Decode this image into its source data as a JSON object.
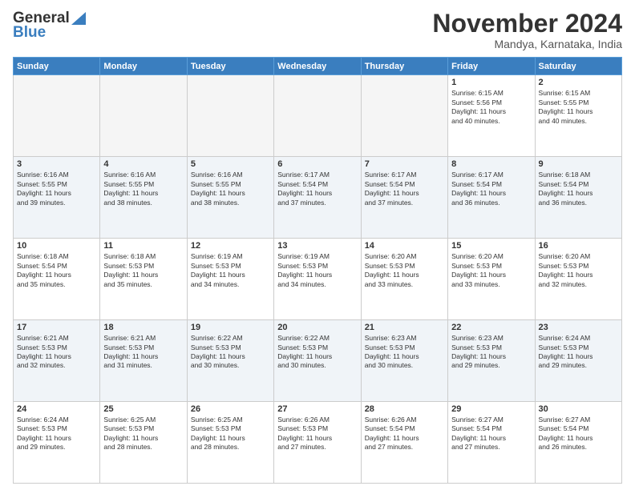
{
  "logo": {
    "line1": "General",
    "line2": "Blue"
  },
  "header": {
    "month": "November 2024",
    "location": "Mandya, Karnataka, India"
  },
  "weekdays": [
    "Sunday",
    "Monday",
    "Tuesday",
    "Wednesday",
    "Thursday",
    "Friday",
    "Saturday"
  ],
  "weeks": [
    [
      {
        "day": "",
        "info": ""
      },
      {
        "day": "",
        "info": ""
      },
      {
        "day": "",
        "info": ""
      },
      {
        "day": "",
        "info": ""
      },
      {
        "day": "",
        "info": ""
      },
      {
        "day": "1",
        "info": "Sunrise: 6:15 AM\nSunset: 5:56 PM\nDaylight: 11 hours\nand 40 minutes."
      },
      {
        "day": "2",
        "info": "Sunrise: 6:15 AM\nSunset: 5:55 PM\nDaylight: 11 hours\nand 40 minutes."
      }
    ],
    [
      {
        "day": "3",
        "info": "Sunrise: 6:16 AM\nSunset: 5:55 PM\nDaylight: 11 hours\nand 39 minutes."
      },
      {
        "day": "4",
        "info": "Sunrise: 6:16 AM\nSunset: 5:55 PM\nDaylight: 11 hours\nand 38 minutes."
      },
      {
        "day": "5",
        "info": "Sunrise: 6:16 AM\nSunset: 5:55 PM\nDaylight: 11 hours\nand 38 minutes."
      },
      {
        "day": "6",
        "info": "Sunrise: 6:17 AM\nSunset: 5:54 PM\nDaylight: 11 hours\nand 37 minutes."
      },
      {
        "day": "7",
        "info": "Sunrise: 6:17 AM\nSunset: 5:54 PM\nDaylight: 11 hours\nand 37 minutes."
      },
      {
        "day": "8",
        "info": "Sunrise: 6:17 AM\nSunset: 5:54 PM\nDaylight: 11 hours\nand 36 minutes."
      },
      {
        "day": "9",
        "info": "Sunrise: 6:18 AM\nSunset: 5:54 PM\nDaylight: 11 hours\nand 36 minutes."
      }
    ],
    [
      {
        "day": "10",
        "info": "Sunrise: 6:18 AM\nSunset: 5:54 PM\nDaylight: 11 hours\nand 35 minutes."
      },
      {
        "day": "11",
        "info": "Sunrise: 6:18 AM\nSunset: 5:53 PM\nDaylight: 11 hours\nand 35 minutes."
      },
      {
        "day": "12",
        "info": "Sunrise: 6:19 AM\nSunset: 5:53 PM\nDaylight: 11 hours\nand 34 minutes."
      },
      {
        "day": "13",
        "info": "Sunrise: 6:19 AM\nSunset: 5:53 PM\nDaylight: 11 hours\nand 34 minutes."
      },
      {
        "day": "14",
        "info": "Sunrise: 6:20 AM\nSunset: 5:53 PM\nDaylight: 11 hours\nand 33 minutes."
      },
      {
        "day": "15",
        "info": "Sunrise: 6:20 AM\nSunset: 5:53 PM\nDaylight: 11 hours\nand 33 minutes."
      },
      {
        "day": "16",
        "info": "Sunrise: 6:20 AM\nSunset: 5:53 PM\nDaylight: 11 hours\nand 32 minutes."
      }
    ],
    [
      {
        "day": "17",
        "info": "Sunrise: 6:21 AM\nSunset: 5:53 PM\nDaylight: 11 hours\nand 32 minutes."
      },
      {
        "day": "18",
        "info": "Sunrise: 6:21 AM\nSunset: 5:53 PM\nDaylight: 11 hours\nand 31 minutes."
      },
      {
        "day": "19",
        "info": "Sunrise: 6:22 AM\nSunset: 5:53 PM\nDaylight: 11 hours\nand 30 minutes."
      },
      {
        "day": "20",
        "info": "Sunrise: 6:22 AM\nSunset: 5:53 PM\nDaylight: 11 hours\nand 30 minutes."
      },
      {
        "day": "21",
        "info": "Sunrise: 6:23 AM\nSunset: 5:53 PM\nDaylight: 11 hours\nand 30 minutes."
      },
      {
        "day": "22",
        "info": "Sunrise: 6:23 AM\nSunset: 5:53 PM\nDaylight: 11 hours\nand 29 minutes."
      },
      {
        "day": "23",
        "info": "Sunrise: 6:24 AM\nSunset: 5:53 PM\nDaylight: 11 hours\nand 29 minutes."
      }
    ],
    [
      {
        "day": "24",
        "info": "Sunrise: 6:24 AM\nSunset: 5:53 PM\nDaylight: 11 hours\nand 29 minutes."
      },
      {
        "day": "25",
        "info": "Sunrise: 6:25 AM\nSunset: 5:53 PM\nDaylight: 11 hours\nand 28 minutes."
      },
      {
        "day": "26",
        "info": "Sunrise: 6:25 AM\nSunset: 5:53 PM\nDaylight: 11 hours\nand 28 minutes."
      },
      {
        "day": "27",
        "info": "Sunrise: 6:26 AM\nSunset: 5:53 PM\nDaylight: 11 hours\nand 27 minutes."
      },
      {
        "day": "28",
        "info": "Sunrise: 6:26 AM\nSunset: 5:54 PM\nDaylight: 11 hours\nand 27 minutes."
      },
      {
        "day": "29",
        "info": "Sunrise: 6:27 AM\nSunset: 5:54 PM\nDaylight: 11 hours\nand 27 minutes."
      },
      {
        "day": "30",
        "info": "Sunrise: 6:27 AM\nSunset: 5:54 PM\nDaylight: 11 hours\nand 26 minutes."
      }
    ]
  ]
}
